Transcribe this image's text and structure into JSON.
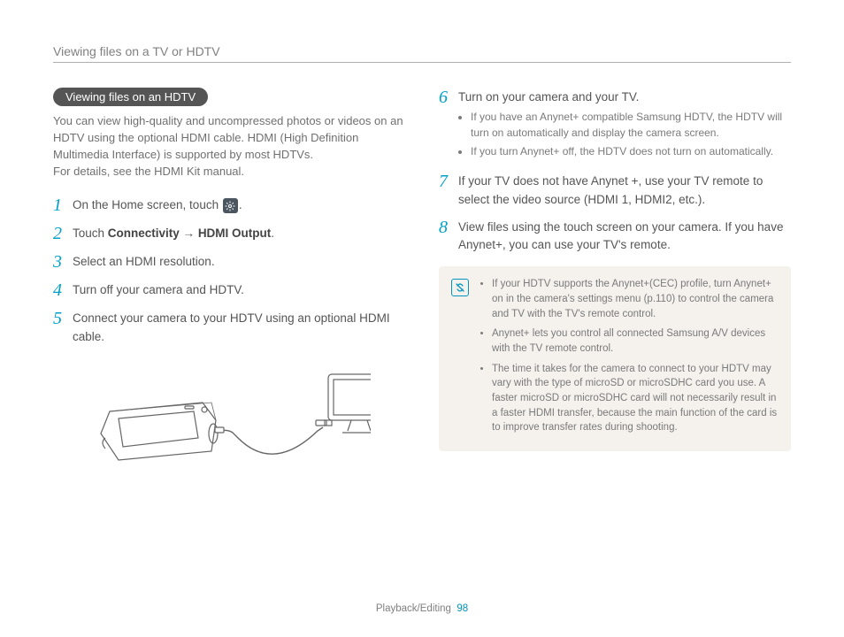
{
  "header": {
    "breadcrumb": "Viewing files on a TV or HDTV"
  },
  "left": {
    "section_pill": "Viewing files on an HDTV",
    "intro": "You can view high-quality and uncompressed photos or videos on an HDTV using the optional HDMI cable. HDMI (High Definition Multimedia Interface) is supported by most HDTVs.\nFor details, see the HDMI Kit manual.",
    "steps": {
      "s1_pre": "On the Home screen, touch ",
      "s1_post": ".",
      "s2_pre": "Touch ",
      "s2_b1": "Connectivity",
      "s2_arrow": " → ",
      "s2_b2": "HDMI Output",
      "s2_post": ".",
      "s3": "Select an HDMI resolution.",
      "s4": "Turn off your camera and HDTV.",
      "s5": "Connect your camera to your HDTV using an optional HDMI cable."
    }
  },
  "right": {
    "steps": {
      "s6": "Turn on your camera and your TV.",
      "s6_sub": [
        "If you have an Anynet+ compatible Samsung HDTV, the HDTV will turn on automatically and display the camera screen.",
        "If you turn Anynet+ off, the HDTV does not turn on automatically."
      ],
      "s7": "If your TV does not have Anynet +, use your TV remote to select the video source (HDMI 1, HDMI2, etc.).",
      "s8": "View files using the touch screen on your camera. If you have Anynet+, you can use your TV's remote."
    },
    "notes": [
      "If your HDTV supports the Anynet+(CEC) profile, turn Anynet+ on in the camera's settings menu (p.110) to control the camera and TV with the TV's remote control.",
      "Anynet+ lets you control all connected Samsung A/V devices with the TV remote control.",
      "The time it takes for the camera to connect to your HDTV may vary with the type of microSD or microSDHC card you use. A faster microSD or microSDHC card will not necessarily result in a faster HDMI transfer, because the main function of the card is to improve transfer rates during shooting."
    ]
  },
  "footer": {
    "section": "Playback/Editing",
    "page": "98"
  }
}
